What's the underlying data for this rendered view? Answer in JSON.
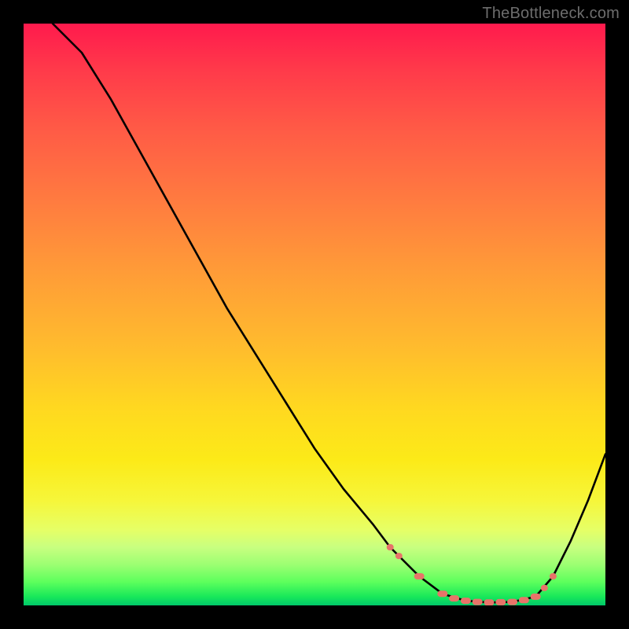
{
  "watermark": "TheBottleneck.com",
  "colors": {
    "frame": "#000000",
    "curve_stroke": "#000000",
    "marker_fill": "#e77469",
    "watermark": "#6d6d6d"
  },
  "chart_data": {
    "type": "line",
    "title": "",
    "xlabel": "",
    "ylabel": "",
    "xlim": [
      0,
      100
    ],
    "ylim": [
      0,
      100
    ],
    "grid": false,
    "note": "Axes are implicit (no tick labels visible). x is approximate horizontal position 0-100 left→right; y is approximate percent height 0-100 bottom→top. The curve is a bottleneck V-shape: steep fall from top-left, flat green valley around x≈72-88, rise toward right.",
    "series": [
      {
        "name": "bottleneck-curve",
        "x": [
          5,
          10,
          15,
          20,
          25,
          30,
          35,
          40,
          45,
          50,
          55,
          60,
          63,
          68,
          72,
          76,
          80,
          84,
          88,
          91,
          94,
          97,
          100
        ],
        "values": [
          100,
          95,
          87,
          78,
          69,
          60,
          51,
          43,
          35,
          27,
          20,
          14,
          10,
          5,
          2,
          0.8,
          0.5,
          0.6,
          1.5,
          5,
          11,
          18,
          26
        ]
      }
    ],
    "markers": {
      "name": "valley-dots",
      "note": "short salmon dashes/dots marking the flat valley segment",
      "x": [
        63,
        64.5,
        68,
        72,
        74,
        76,
        78,
        80,
        82,
        84,
        86,
        88,
        89.5,
        91
      ],
      "values": [
        10,
        8.5,
        5,
        2,
        1.2,
        0.8,
        0.6,
        0.5,
        0.55,
        0.6,
        0.9,
        1.5,
        3,
        5
      ]
    }
  }
}
